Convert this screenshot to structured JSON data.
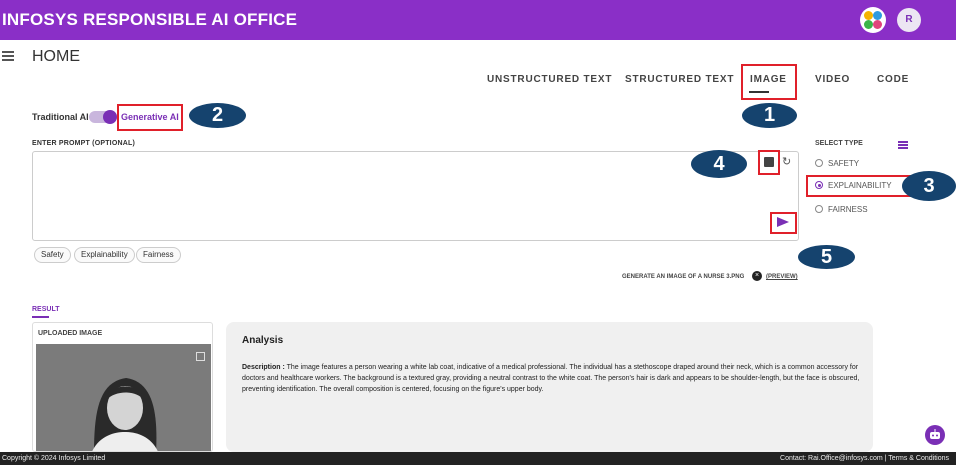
{
  "app": {
    "title": "INFOSYS RESPONSIBLE AI OFFICE",
    "user_initial": "R"
  },
  "page": {
    "title": "HOME"
  },
  "tabs": [
    {
      "label": "UNSTRUCTURED TEXT"
    },
    {
      "label": "STRUCTURED TEXT"
    },
    {
      "label": "IMAGE",
      "active": true
    },
    {
      "label": "VIDEO"
    },
    {
      "label": "CODE"
    }
  ],
  "mode": {
    "traditional_label": "Traditional AI",
    "generative_label": "Generative AI",
    "generative_on": true
  },
  "prompt": {
    "label": "ENTER PROMPT (OPTIONAL)",
    "value": "",
    "chips": [
      "Safety",
      "Explainability",
      "Fairness"
    ]
  },
  "select_type": {
    "label": "SELECT TYPE",
    "options": [
      {
        "label": "SAFETY",
        "selected": false
      },
      {
        "label": "EXPLAINABILITY",
        "selected": true
      },
      {
        "label": "FAIRNESS",
        "selected": false
      }
    ]
  },
  "attachment": {
    "file_name": "GENERATE AN IMAGE OF A NURSE 3.PNG",
    "preview_label": "(PREVIEW)"
  },
  "annotations": [
    "1",
    "2",
    "3",
    "4",
    "5"
  ],
  "result": {
    "tab_label": "RESULT",
    "uploaded_image_title": "UPLOADED IMAGE",
    "analysis_title": "Analysis",
    "description_label": "Description :",
    "description_text": "The image features a person wearing a white lab coat, indicative of a medical professional. The individual has a stethoscope draped around their neck, which is a common accessory for doctors and healthcare workers. The background is a textured gray, providing a neutral contrast to the white coat. The person's hair is dark and appears to be shoulder-length, but the face is obscured, preventing identification. The overall composition is centered, focusing on the figure's upper body."
  },
  "footer": {
    "copyright": "Copyright © 2024 Infosys Limited",
    "contact": "Contact: Rai.Office@infosys.com | Terms & Conditions"
  },
  "colors": {
    "brand": "#8a2fc7",
    "accent": "#7a2fb5",
    "marker": "#e0202a",
    "badge": "#15436e",
    "footer": "#222222"
  },
  "icons": [
    "menu-icon",
    "image-upload-icon",
    "refresh-icon",
    "send-icon",
    "filter-icon",
    "close-icon",
    "expand-icon",
    "chatbot-icon"
  ]
}
